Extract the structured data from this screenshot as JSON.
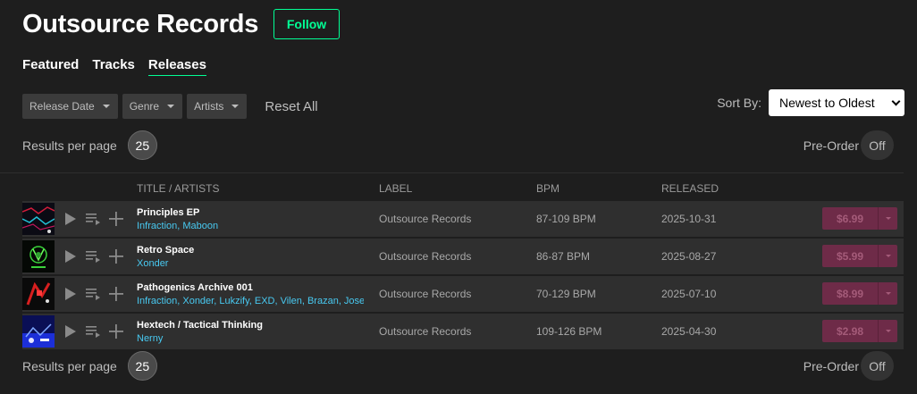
{
  "header": {
    "title": "Outsource Records",
    "follow_label": "Follow"
  },
  "tabs": [
    {
      "label": "Featured",
      "active": false
    },
    {
      "label": "Tracks",
      "active": false
    },
    {
      "label": "Releases",
      "active": true
    }
  ],
  "filters": {
    "release_date": "Release Date",
    "genre": "Genre",
    "artists": "Artists",
    "reset": "Reset All"
  },
  "sort": {
    "label": "Sort By:",
    "value": "Newest to Oldest"
  },
  "pagination_top": {
    "label": "Results per page",
    "value": "25"
  },
  "pagination_bottom": {
    "label": "Results per page",
    "value": "25"
  },
  "preorder_top": {
    "label": "Pre-Order",
    "state": "Off"
  },
  "preorder_bottom": {
    "label": "Pre-Order",
    "state": "Off"
  },
  "columns": {
    "title": "TITLE / ARTISTS",
    "label": "LABEL",
    "bpm": "BPM",
    "released": "RELEASED"
  },
  "releases": [
    {
      "title": "Principles EP",
      "artists": "Infraction, Maboon",
      "label": "Outsource Records",
      "bpm": "87-109 BPM",
      "released": "2025-10-31",
      "price": "$6.99"
    },
    {
      "title": "Retro Space",
      "artists": "Xonder",
      "label": "Outsource Records",
      "bpm": "86-87 BPM",
      "released": "2025-08-27",
      "price": "$5.99"
    },
    {
      "title": "Pathogenics Archive 001",
      "artists": "Infraction, Xonder, Lukzify, EXD, Vilen, Brazan, Josep",
      "label": "Outsource Records",
      "bpm": "70-129 BPM",
      "released": "2025-07-10",
      "price": "$8.99"
    },
    {
      "title": "Hextech / Tactical Thinking",
      "artists": "Nerny",
      "label": "Outsource Records",
      "bpm": "109-126 BPM",
      "released": "2025-04-30",
      "price": "$2.98"
    }
  ],
  "colors": {
    "accent": "#01ff95",
    "artist_link": "#48c9f1",
    "price_bg": "#6e2b48",
    "row_bg": "#2f2f2f",
    "page_bg": "#1e1e1e"
  }
}
